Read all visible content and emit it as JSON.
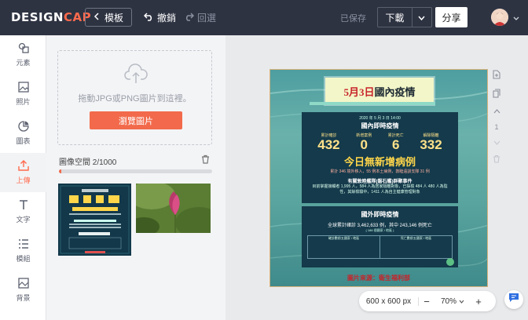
{
  "header": {
    "logo_design": "DESIGN",
    "logo_cap": "CAP",
    "back_label": "模板",
    "undo_label": "撤銷",
    "redo_label": "回選",
    "saved_label": "已保存",
    "download_label": "下載",
    "share_label": "分享"
  },
  "sidebar": {
    "items": [
      {
        "label": "元素",
        "icon": "elements-icon"
      },
      {
        "label": "照片",
        "icon": "photo-icon"
      },
      {
        "label": "圖表",
        "icon": "chart-icon"
      },
      {
        "label": "上傳",
        "icon": "upload-icon",
        "active": true
      },
      {
        "label": "文字",
        "icon": "text-icon"
      },
      {
        "label": "模組",
        "icon": "modules-icon"
      },
      {
        "label": "背景",
        "icon": "background-icon"
      }
    ]
  },
  "upload_panel": {
    "dropzone_text": "拖動JPG或PNG圖片到這裡。",
    "browse_label": "瀏覽圖片",
    "storage_label": "圖像空間 2/1000",
    "storage_used_fraction": 0.002
  },
  "poster": {
    "title_date": "5月3日",
    "title_rest": "國內疫情",
    "date_line": "2020 年 5 月 3 日 14:00",
    "domestic_heading": "國內即時疫情",
    "stats": [
      {
        "label": "累計確診",
        "value": "432"
      },
      {
        "label": "新增案例",
        "value": "0"
      },
      {
        "label": "累計死亡",
        "value": "6"
      },
      {
        "label": "解除隔離",
        "value": "332"
      }
    ],
    "no_new_heading": "今日無新增病例",
    "no_new_sub": "累計 346 境外移入，55 例本土病例，敦睦遠訓支隊 31 例",
    "event_title": "有關敦睦艦隊(磐石艦)群聚事件",
    "event_body": "目前掌握接觸者 1,995 人，584 人為居家隔離對象，已採檢 484 人 480 人為陰性，其餘檢驗中，1411 人為自主健康管理對象",
    "global_heading": "國外即時疫情",
    "global_line": "全球累計確診 3,462,633 例，其中 243,146 例死亡",
    "global_sub": "( 186 個國家 / 地區 )",
    "table_left": "確診數前五國家 / 地區",
    "table_right": "死亡數前五國家 / 地區",
    "source": "圖片來源：衛生福利部"
  },
  "canvas": {
    "page_number": "1",
    "size_label": "600 x 600 px",
    "zoom_label": "70%"
  },
  "colors": {
    "topbar": "#2e3342",
    "accent": "#f26a4b"
  }
}
